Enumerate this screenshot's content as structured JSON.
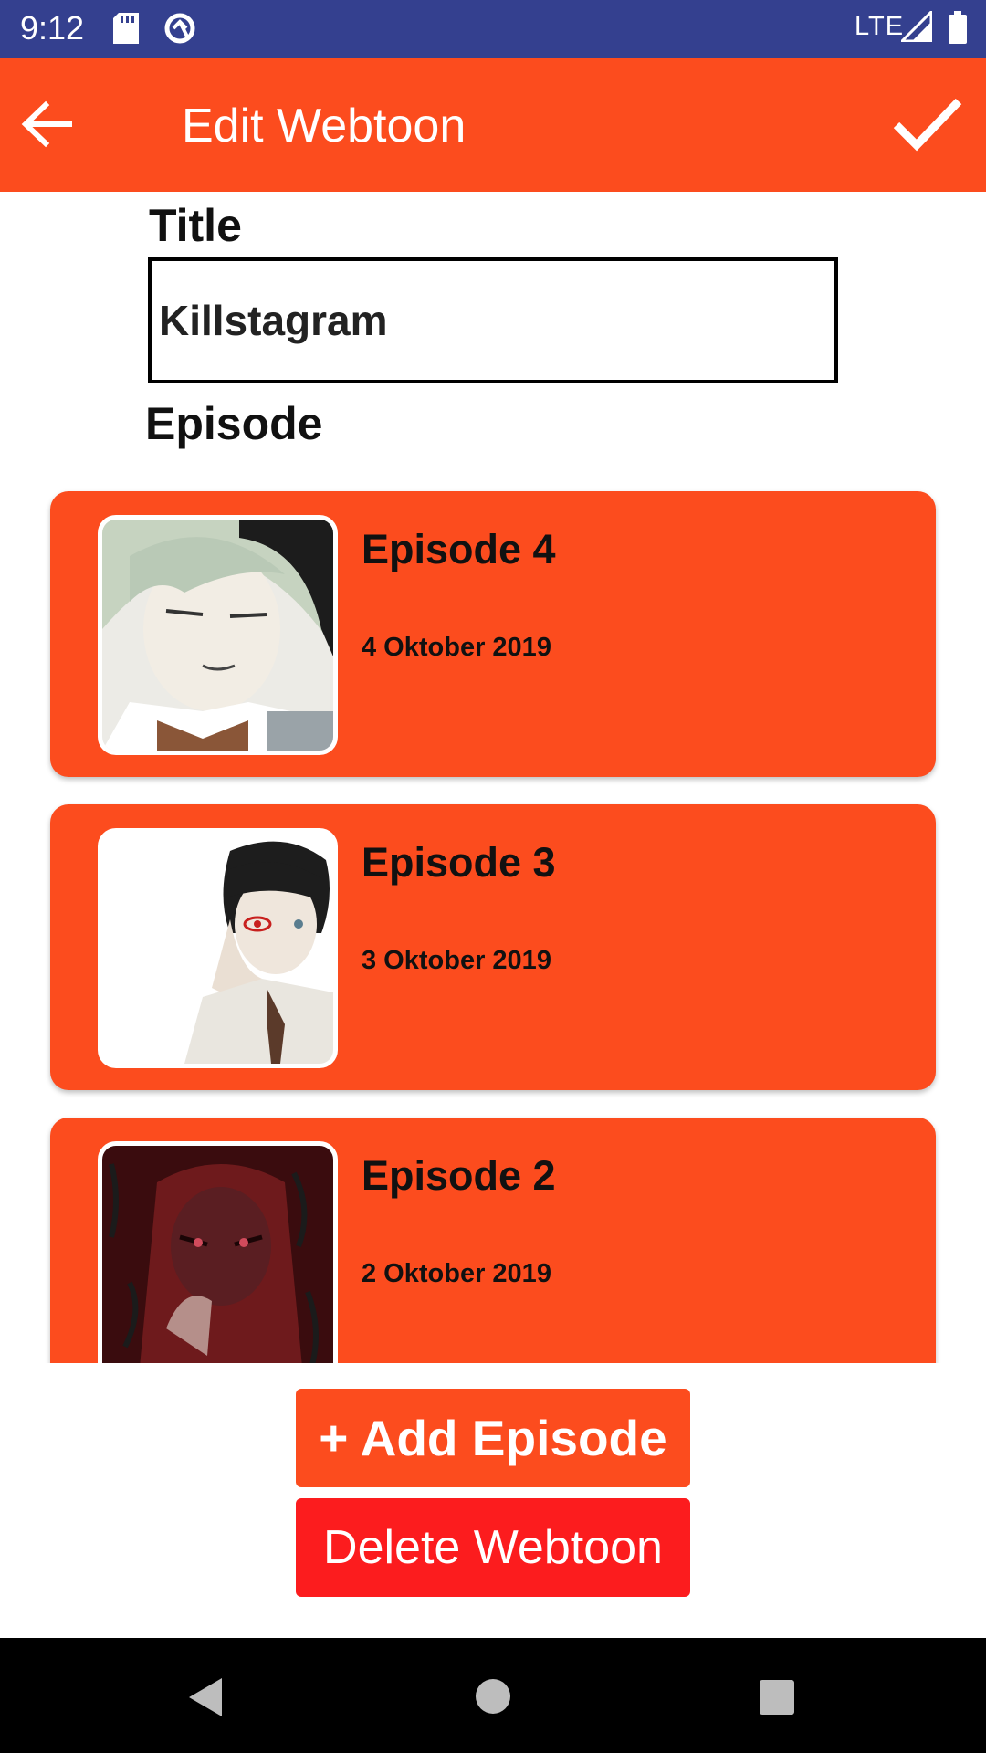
{
  "status_bar": {
    "time": "9:12",
    "network": "LTE",
    "icons": [
      "sd-card-icon",
      "sync-icon",
      "signal-icon",
      "battery-icon"
    ]
  },
  "app_bar": {
    "title": "Edit Webtoon",
    "back_icon": "arrow-back-icon",
    "save_icon": "check-icon"
  },
  "form": {
    "title_label": "Title",
    "title_value": "Killstagram",
    "episode_label": "Episode"
  },
  "episodes": [
    {
      "name": "Episode 4",
      "date": "4 Oktober 2019"
    },
    {
      "name": "Episode 3",
      "date": "3 Oktober 2019"
    },
    {
      "name": "Episode 2",
      "date": "2 Oktober 2019"
    }
  ],
  "buttons": {
    "add_episode": "+ Add Episode",
    "delete_webtoon": "Delete Webtoon"
  },
  "colors": {
    "status_bar": "#34408f",
    "accent": "#fc4c1e",
    "danger": "#fc1c1e",
    "nav_bar": "#000000"
  },
  "nav_bar": {
    "icons": [
      "nav-back-icon",
      "nav-home-icon",
      "nav-recents-icon"
    ]
  }
}
